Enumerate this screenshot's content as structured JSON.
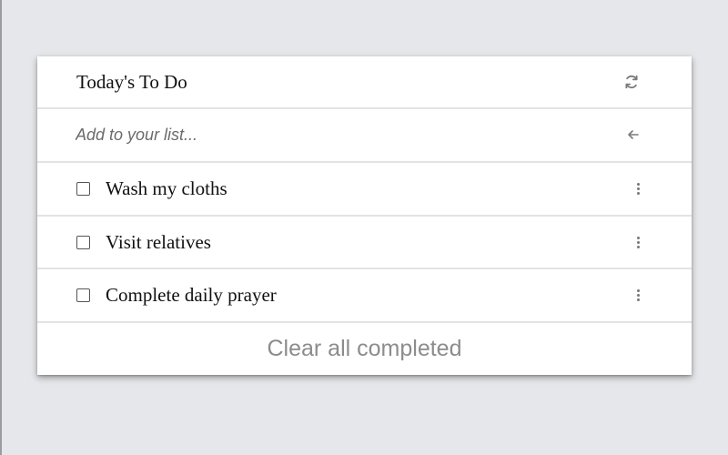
{
  "header": {
    "title": "Today's To Do",
    "refresh_icon": "refresh-icon"
  },
  "add": {
    "placeholder": "Add to your list...",
    "value": "",
    "submit_icon": "arrow-left-icon"
  },
  "items": [
    {
      "label": "Wash my cloths",
      "checked": false
    },
    {
      "label": "Visit relatives",
      "checked": false
    },
    {
      "label": "Complete daily prayer",
      "checked": false
    }
  ],
  "footer": {
    "clear_label": "Clear all completed"
  },
  "colors": {
    "background": "#e6e7ea",
    "card": "#ffffff",
    "divider": "#e3e3e3",
    "muted_text": "#8c8c8c"
  }
}
